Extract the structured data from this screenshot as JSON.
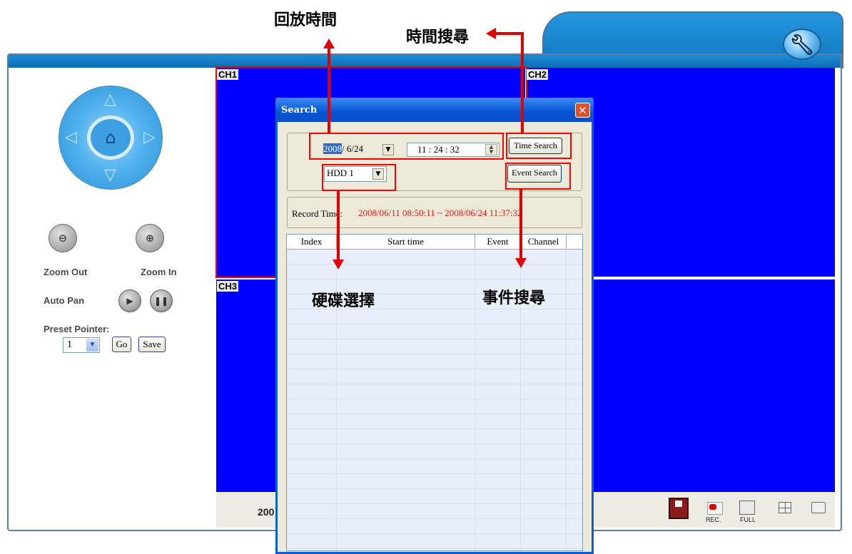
{
  "annotations": {
    "playback_time": "回放時間",
    "time_search": "時間搜尋",
    "hdd_select": "硬碟選擇",
    "event_search": "事件搜尋"
  },
  "left_panel": {
    "zoom_out_label": "Zoom Out",
    "zoom_in_label": "Zoom In",
    "auto_pan_label": "Auto Pan",
    "preset_label": "Preset Pointer:",
    "preset_value": "1",
    "go_label": "Go",
    "save_label": "Save"
  },
  "channels": {
    "ch1": "CH1",
    "ch2": "CH2",
    "ch3": "CH3"
  },
  "status_bar": {
    "date_text": "200"
  },
  "bottom_icons": {
    "rec_label": "REC.",
    "full_label": "FULL"
  },
  "dialog": {
    "title": "Search",
    "year": "2008",
    "month_day": "/ 6/24",
    "time": "11 : 24 : 32",
    "time_search_btn": "Time Search",
    "hdd_value": "HDD 1",
    "event_search_btn": "Event Search",
    "record_time_label": "Record Time:",
    "record_time_value": "2008/06/11 08:50:11 ~ 2008/06/24 11:37:32",
    "columns": [
      "Index",
      "Start time",
      "Event",
      "Channel"
    ]
  },
  "colors": {
    "video_blue": "#0000ff",
    "highlight_red": "#ff0000",
    "title_bar_blue": "#0654d4",
    "record_time_red": "#e31b1b"
  }
}
